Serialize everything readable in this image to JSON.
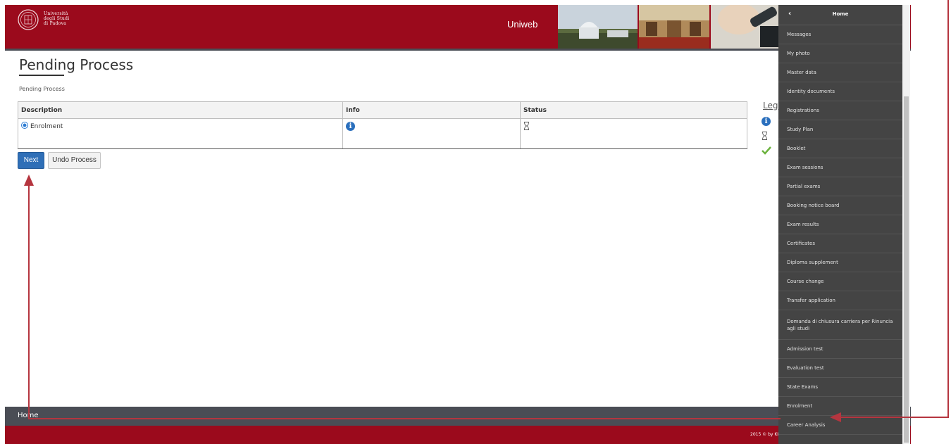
{
  "header": {
    "university_lines": [
      "Università",
      "degli Studi",
      "di Padova"
    ],
    "app_name": "Uniweb",
    "brand_color": "#9b0a1c"
  },
  "page": {
    "title": "Pending Process",
    "breadcrumb": "Pending Process"
  },
  "table": {
    "columns": [
      "Description",
      "Info",
      "Status"
    ],
    "rows": [
      {
        "description": "Enrolment",
        "info_icon": "info-icon",
        "status_icon": "hourglass-icon",
        "selected": true
      }
    ]
  },
  "buttons": {
    "next": "Next",
    "undo": "Undo Process"
  },
  "legend": {
    "title_partial": "Leg",
    "icons": [
      "info-icon",
      "hourglass-icon",
      "check-icon"
    ]
  },
  "footer": {
    "home_partial": "Home",
    "copyright_partial": "2015 © by KI"
  },
  "sidebar": {
    "back_glyph": "‹",
    "title": "Home",
    "items": [
      "Messages",
      "My photo",
      "Master data",
      "Identity documents",
      "Registrations",
      "Study Plan",
      "Booklet",
      "Exam sessions",
      "Partial exams",
      "Booking notice board",
      "Exam results",
      "Certificates",
      "Diploma supplement",
      "Course change",
      "Transfer application",
      "Domanda di chiusura carriera per Rinuncia agli studi",
      "Admission test",
      "Evaluation test",
      "State Exams",
      "Enrolment",
      "Career Analysis"
    ]
  },
  "colors": {
    "accent_blue": "#2f6fb7",
    "annotation_red": "#b5353f",
    "sidebar_bg": "#444444",
    "footer_gray": "#4a4d55"
  }
}
